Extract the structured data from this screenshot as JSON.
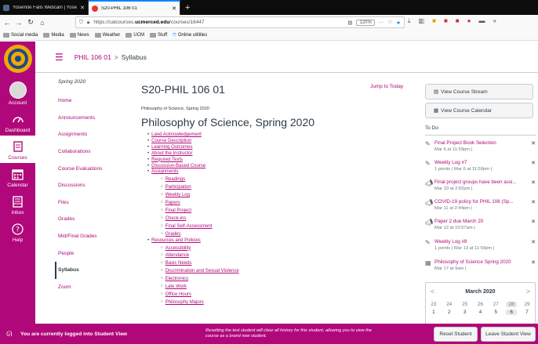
{
  "browser": {
    "tabs": [
      {
        "title": "Yosemite Falls Webcam | Yose",
        "active": false
      },
      {
        "title": "S20-PHIL 106 01",
        "active": true
      }
    ],
    "new_tab": "+",
    "url_prefix": "https://catcourses.",
    "url_domain": "ucmerced.edu",
    "url_path": "/courses/16447",
    "zoom": "120%",
    "more": "···",
    "bookmarks": [
      "Social media",
      "Media",
      "News",
      "Weather",
      "UCM",
      "Stuff",
      "Online utilities"
    ]
  },
  "global_nav": {
    "items": [
      {
        "label": "Account",
        "icon": "avatar-icon"
      },
      {
        "label": "Dashboard",
        "icon": "dashboard-icon"
      },
      {
        "label": "Courses",
        "icon": "courses-icon",
        "selected": true
      },
      {
        "label": "Calendar",
        "icon": "calendar-icon"
      },
      {
        "label": "Inbox",
        "icon": "inbox-icon"
      },
      {
        "label": "Help",
        "icon": "help-icon"
      }
    ]
  },
  "header": {
    "course": "PHIL 106 01",
    "separator": ">",
    "page": "Syllabus"
  },
  "course_nav": {
    "term": "Spring 2020",
    "items": [
      "Home",
      "Announcements",
      "Assignments",
      "Collaborations",
      "Course Evaluations",
      "Discussions",
      "Files",
      "Grades",
      "Mid/Final Grades",
      "People",
      "Syllabus",
      "Zoom"
    ],
    "selected": "Syllabus"
  },
  "main": {
    "course_title": "S20-PHIL 106 01",
    "jump_link": "Jump to Today",
    "subtitle": "Philosophy of Science, Spring 2020",
    "heading": "Philosophy of Science, Spring 2020",
    "toc": [
      {
        "label": "Land Acknowledgement"
      },
      {
        "label": "Course Description"
      },
      {
        "label": "Learning Outcomes"
      },
      {
        "label": "About the Instructor"
      },
      {
        "label": "Required Texts"
      },
      {
        "label": "Discussion-Based Course"
      },
      {
        "label": "Assignments",
        "children": [
          "Readings",
          "Participation",
          "Weekly Log",
          "Papers",
          "Final Project",
          "Check-ins",
          "Final Self-Assessment",
          "Grades"
        ]
      },
      {
        "label": "Resources and Policies",
        "children": [
          "Accessibility",
          "Attendance",
          "Basic Needs",
          "Discrimination and Sexual Violence",
          "Electronics",
          "Late Work",
          "Office Hours",
          "Philosophy Majors"
        ]
      }
    ]
  },
  "sidebar": {
    "stream_btn": "View Course Stream",
    "calendar_btn": "View Course Calendar",
    "todo_heading": "To Do",
    "todos": [
      {
        "title": "Final Project Book Selection",
        "meta": "Mar 6 at 11:59pm  |",
        "icon": "assignment-icon"
      },
      {
        "title": "Weekly Log #7",
        "meta": "1 points  |  Mar 6 at 11:59pm  |",
        "icon": "assignment-icon"
      },
      {
        "title": "Final project groups have been assi...",
        "meta": "Mar 10 at 2:02pm  |",
        "icon": "announcement-icon"
      },
      {
        "title": "COVID-19 policy for PHIL 106 (Sp...",
        "meta": "Mar 11 at 2:44pm  |",
        "icon": "announcement-icon"
      },
      {
        "title": "Paper 2 due March 20",
        "meta": "Mar 12 at 10:57am  |",
        "icon": "announcement-icon"
      },
      {
        "title": "Weekly Log #8",
        "meta": "1 points  |  Mar 13 at 11:59pm  |",
        "icon": "assignment-icon"
      },
      {
        "title": "Philosophy of Science Spring 2020",
        "meta": "Mar 17 at 9am  |",
        "icon": "calendar-event-icon"
      }
    ],
    "calendar": {
      "month": "March 2020",
      "prev": "<",
      "next": ">",
      "rows": [
        [
          "23",
          "24",
          "25",
          "26",
          "27",
          "28",
          "29"
        ],
        [
          "1",
          "2",
          "3",
          "4",
          "5",
          "6",
          "7"
        ]
      ],
      "today": "6"
    }
  },
  "student_view": {
    "message": "You are currently logged into Student View",
    "info": "Resetting the test student will clear all history for this student, allowing you to view the course as a brand new student.",
    "reset_btn": "Reset Student",
    "leave_btn": "Leave Student View"
  },
  "colors": {
    "brand": "#b0087a",
    "logo": "#f0a80a"
  }
}
